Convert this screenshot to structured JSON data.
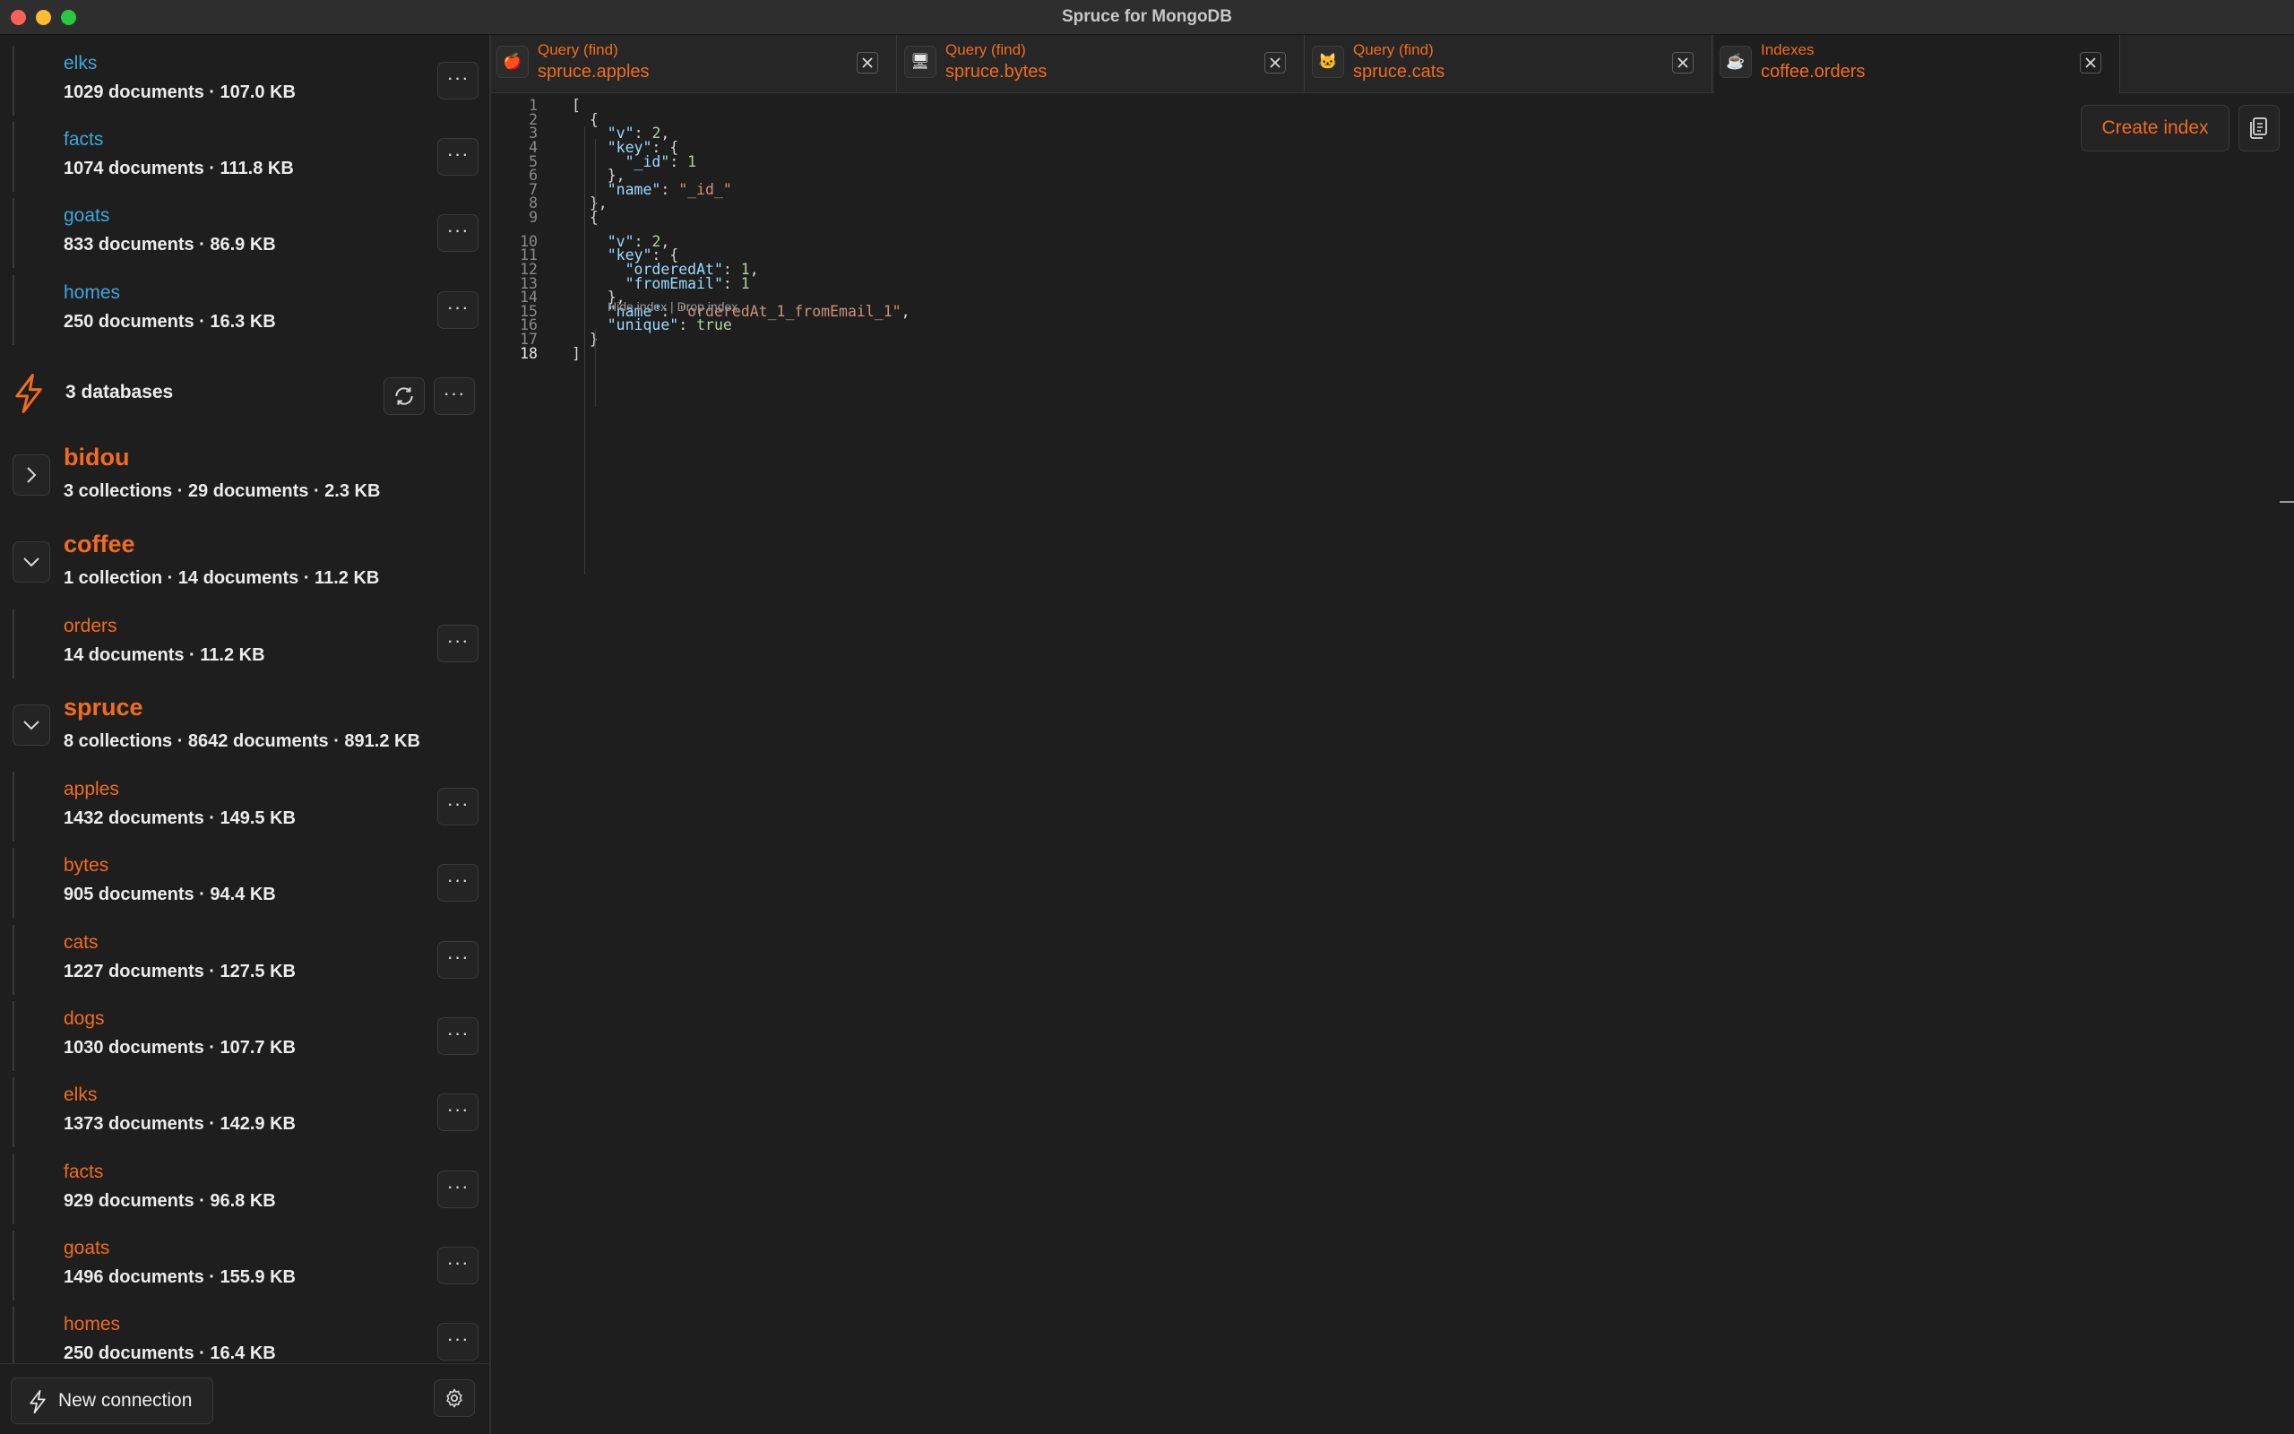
{
  "window": {
    "title": "Spruce for MongoDB"
  },
  "sidebar": {
    "top_collections": [
      {
        "name": "elks",
        "meta": "1029 documents · 107.0 KB"
      },
      {
        "name": "facts",
        "meta": "1074 documents · 111.8 KB"
      },
      {
        "name": "goats",
        "meta": "833 documents · 86.9 KB"
      },
      {
        "name": "homes",
        "meta": "250 documents · 16.3 KB"
      }
    ],
    "connection": {
      "label": "3 databases",
      "icon": "bolt-icon"
    },
    "databases": [
      {
        "name": "bidou",
        "meta": "3 collections · 29 documents · 2.3 KB",
        "expanded": false
      },
      {
        "name": "coffee",
        "meta": "1 collection · 14 documents · 11.2 KB",
        "expanded": true,
        "collections": [
          {
            "name": "orders",
            "meta": "14 documents · 11.2 KB"
          }
        ]
      },
      {
        "name": "spruce",
        "meta": "8 collections · 8642 documents · 891.2 KB",
        "expanded": true,
        "collections": [
          {
            "name": "apples",
            "meta": "1432 documents · 149.5 KB"
          },
          {
            "name": "bytes",
            "meta": "905 documents · 94.4 KB"
          },
          {
            "name": "cats",
            "meta": "1227 documents · 127.5 KB"
          },
          {
            "name": "dogs",
            "meta": "1030 documents · 107.7 KB"
          },
          {
            "name": "elks",
            "meta": "1373 documents · 142.9 KB"
          },
          {
            "name": "facts",
            "meta": "929 documents · 96.8 KB"
          },
          {
            "name": "goats",
            "meta": "1496 documents · 155.9 KB"
          },
          {
            "name": "homes",
            "meta": "250 documents · 16.4 KB"
          }
        ]
      }
    ],
    "more_label": "···",
    "footer": {
      "new_connection_label": "New connection"
    }
  },
  "tabs": [
    {
      "kind": "Query (find)",
      "title": "spruce.apples",
      "icon": "🍎",
      "active": false
    },
    {
      "kind": "Query (find)",
      "title": "spruce.bytes",
      "icon": "🖥",
      "active": false
    },
    {
      "kind": "Query (find)",
      "title": "spruce.cats",
      "icon": "🐱",
      "active": false
    },
    {
      "kind": "Indexes",
      "title": "coffee.orders",
      "icon": "☕",
      "active": true
    }
  ],
  "editor": {
    "create_index_label": "Create index",
    "codelens": "Hide index | Drop index",
    "lines": [
      "[",
      "  {",
      "    \"v\": 2,",
      "    \"key\": {",
      "      \"_id\": 1",
      "    },",
      "    \"name\": \"_id_\"",
      "  },",
      "  {",
      "    \"v\": 2,",
      "    \"key\": {",
      "      \"orderedAt\": 1,",
      "      \"fromEmail\": 1",
      "    },",
      "    \"name\": \"orderedAt_1_fromEmail_1\",",
      "    \"unique\": true",
      "  }",
      "]"
    ]
  },
  "colors": {
    "accent": "#f26c1e",
    "link_blue": "#3fa6d9",
    "background": "#1e1e1e"
  }
}
